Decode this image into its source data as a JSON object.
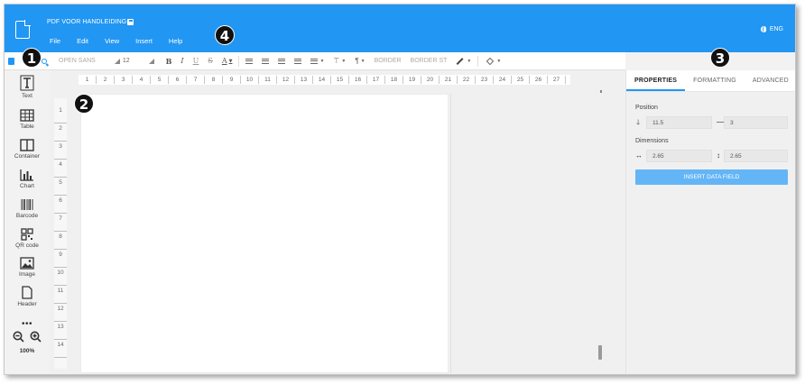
{
  "header": {
    "doc_title": "PDF VOOR HANDLEIDING",
    "menu": [
      "File",
      "Edit",
      "View",
      "Insert",
      "Help"
    ],
    "lang": "ENG"
  },
  "toolbar": {
    "font_family": "OPEN SANS",
    "font_size": "12",
    "bold": "B",
    "italic": "I",
    "underline": "U",
    "strike": "S",
    "text_color": "A",
    "border": "BORDER",
    "border_style": "BORDER ST"
  },
  "sidebar": {
    "items": [
      "Text",
      "Table",
      "Container",
      "Chart",
      "Barcode",
      "QR code",
      "Image",
      "Header"
    ],
    "more": "•••",
    "zoom": "100%"
  },
  "rulers": {
    "horizontal": [
      "1",
      "2",
      "3",
      "4",
      "5",
      "6",
      "7",
      "8",
      "9",
      "10",
      "11",
      "12",
      "13",
      "14",
      "15",
      "16",
      "17",
      "18",
      "19",
      "20",
      "21",
      "22",
      "23",
      "24",
      "25",
      "26",
      "27"
    ],
    "vertical": [
      "1",
      "2",
      "3",
      "4",
      "5",
      "6",
      "7",
      "8",
      "9",
      "10",
      "11",
      "12",
      "13",
      "14"
    ]
  },
  "panel": {
    "tabs": [
      "PROPERTIES",
      "FORMATTING",
      "ADVANCED"
    ],
    "position_label": "Position",
    "pos_y": "11.5",
    "pos_x": "3",
    "dimensions_label": "Dimensions",
    "width": "2.65",
    "height": "2.65",
    "insert_button": "INSERT DATA FIELD"
  },
  "callouts": [
    "1",
    "2",
    "3",
    "4"
  ],
  "colors": {
    "accent": "#2196f3",
    "button": "#64b5f6",
    "panel_bg": "#f0f0f0"
  }
}
